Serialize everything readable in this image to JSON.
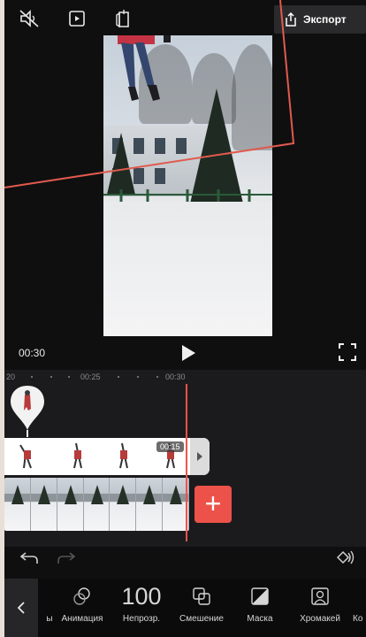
{
  "topbar": {
    "export_label": "Экспорт"
  },
  "preview": {
    "current_time": "00:30"
  },
  "timeline": {
    "ruler": {
      "left_label": "20",
      "mid_label": "00:25",
      "right_label": "00:30"
    },
    "overlay_clip_label": "00:15"
  },
  "toolbar": {
    "tools": [
      {
        "label": "ы"
      },
      {
        "label": "Анимация"
      },
      {
        "label": "Непрозр.",
        "value": "100"
      },
      {
        "label": "Смешение"
      },
      {
        "label": "Маска"
      },
      {
        "label": "Хромакей"
      },
      {
        "label": "Ко"
      }
    ]
  },
  "colors": {
    "accent": "#ec5249",
    "background": "#0f0f10",
    "timeline_bg": "#1b1b1d",
    "toolbar_bg": "#0b0b0c"
  },
  "icons": [
    "no-sound-icon",
    "play-window-icon",
    "copy-icon",
    "share-icon",
    "play-icon",
    "fullscreen-icon",
    "undo-icon",
    "redo-icon",
    "keyframe-icon",
    "chevron-left-icon",
    "animation-icon",
    "blend-icon",
    "mask-icon",
    "chroma-key-icon",
    "plus-icon"
  ]
}
